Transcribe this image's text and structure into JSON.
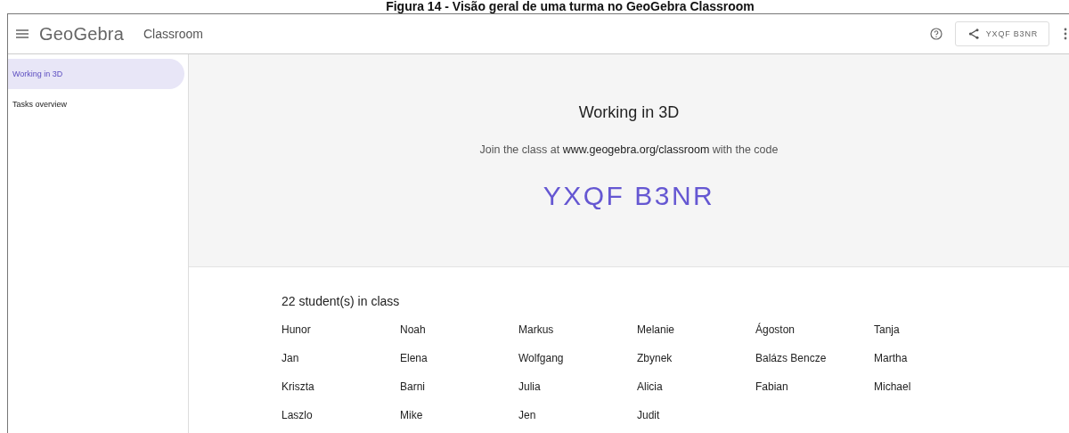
{
  "caption": "Figura 14 - Visão geral de uma turma no GeoGebra Classroom",
  "header": {
    "logo": "GeoGebra",
    "app_name": "Classroom",
    "share_code": "YXQF B3NR"
  },
  "sidebar": {
    "items": [
      {
        "label": "Working in 3D",
        "selected": true
      },
      {
        "label": "Tasks overview",
        "selected": false
      }
    ]
  },
  "hero": {
    "title": "Working in 3D",
    "instructions": "Join the class at **www.geogebra.org/classroom** with the code",
    "code": "YXQF B3NR"
  },
  "students": {
    "count_label": "22 student(s) in class",
    "names": [
      "Hunor",
      "Noah",
      "Markus",
      "Melanie",
      "Ágoston",
      "Tanja",
      "Jan",
      "Elena",
      "Wolfgang",
      "Zbynek",
      "Balázs Bencze",
      "Martha",
      "Kriszta",
      "Barni",
      "Julia",
      "Alicia",
      "Fabian",
      "Michael",
      "Laszlo",
      "Mike",
      "Jen",
      "Judit"
    ]
  }
}
